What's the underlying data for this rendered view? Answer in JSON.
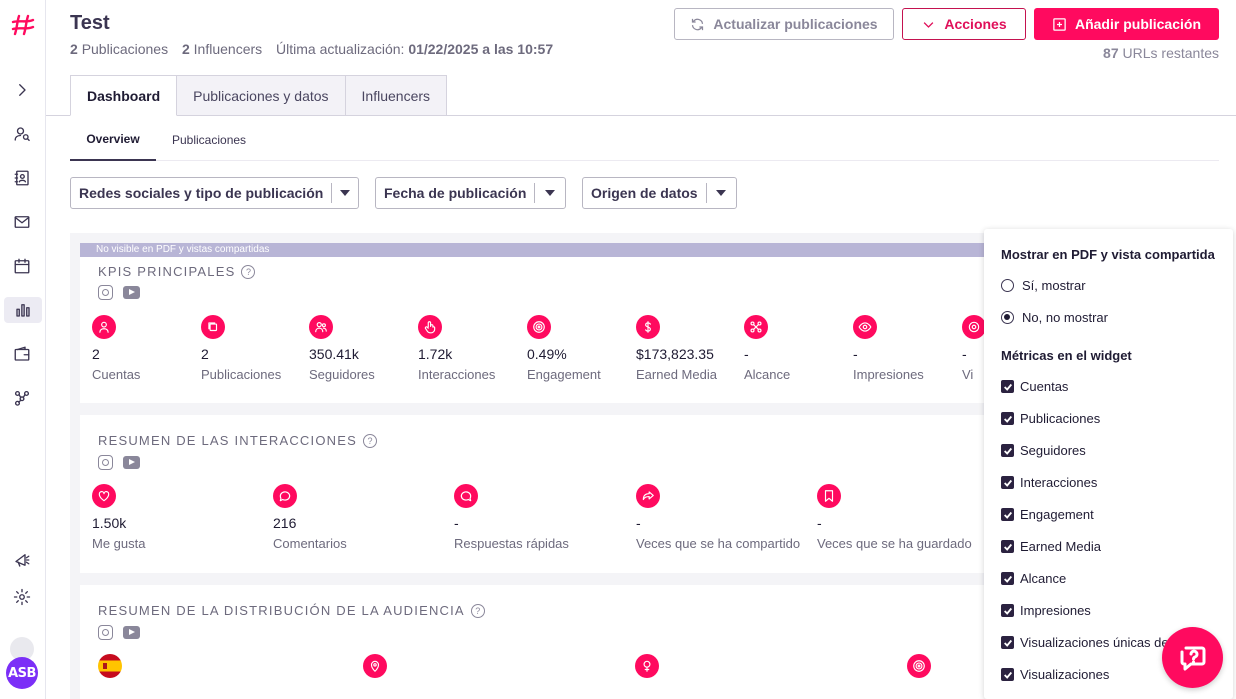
{
  "header": {
    "title": "Test",
    "posts_count": "2",
    "posts_label": "Publicaciones",
    "influencers_count": "2",
    "influencers_label": "Influencers",
    "last_update_label": "Última actualización:",
    "last_update_value": "01/22/2025 a las 10:57",
    "refresh_button": "Actualizar publicaciones",
    "actions_button": "Acciones",
    "add_button": "Añadir publicación",
    "urls_count": "87",
    "urls_label": "URLs restantes"
  },
  "sidebar": {
    "avatar_initials": "ASB",
    "icons": [
      "expand-icon",
      "user-search-icon",
      "contacts-icon",
      "mail-icon",
      "calendar-icon",
      "chart-icon",
      "wallet-icon",
      "network-icon",
      "megaphone-icon",
      "gear-icon"
    ]
  },
  "tabs": [
    "Dashboard",
    "Publicaciones y datos",
    "Influencers"
  ],
  "subtabs": [
    "Overview",
    "Publicaciones"
  ],
  "filters": [
    "Redes sociales y tipo de publicación",
    "Fecha de publicación",
    "Origen de datos"
  ],
  "banner": "No visible en PDF y vistas compartidas",
  "kpis": {
    "title": "KPIS PRINCIPALES",
    "metrics": [
      {
        "value": "2",
        "label": "Cuentas",
        "icon": "user-icon"
      },
      {
        "value": "2",
        "label": "Publicaciones",
        "icon": "posts-icon"
      },
      {
        "value": "350.41k",
        "label": "Seguidores",
        "icon": "followers-icon"
      },
      {
        "value": "1.72k",
        "label": "Interacciones",
        "icon": "tap-icon"
      },
      {
        "value": "0.49%",
        "label": "Engagement",
        "icon": "target-icon"
      },
      {
        "value": "$173,823.35",
        "label": "Earned Media",
        "icon": "dollar-icon"
      },
      {
        "value": "-",
        "label": "Alcance",
        "icon": "reach-icon"
      },
      {
        "value": "-",
        "label": "Impresiones",
        "icon": "eye-icon"
      },
      {
        "value": "-",
        "label": "Vi",
        "icon": "views-icon"
      }
    ]
  },
  "interactions": {
    "title": "RESUMEN DE LAS INTERACCIONES",
    "metrics": [
      {
        "value": "1.50k",
        "label": "Me gusta",
        "icon": "heart-icon"
      },
      {
        "value": "216",
        "label": "Comentarios",
        "icon": "comment-icon"
      },
      {
        "value": "-",
        "label": "Respuestas rápidas",
        "icon": "reply-icon"
      },
      {
        "value": "-",
        "label": "Veces que se ha compartido",
        "icon": "share-icon"
      },
      {
        "value": "-",
        "label": "Veces que se ha guardado",
        "icon": "bookmark-icon"
      }
    ]
  },
  "audience": {
    "title": "RESUMEN DE LA DISTRIBUCIÓN DE LA AUDIENCIA"
  },
  "panel": {
    "show_title": "Mostrar en PDF y vista compartida",
    "option_yes": "Sí, mostrar",
    "option_no": "No, no mostrar",
    "selected": "no",
    "metrics_title": "Métricas en el widget",
    "metrics": [
      "Cuentas",
      "Publicaciones",
      "Seguidores",
      "Interacciones",
      "Engagement",
      "Earned Media",
      "Alcance",
      "Impresiones",
      "Visualizaciones únicas de",
      "Visualizaciones"
    ]
  },
  "colors": {
    "brand": "#ff0a5f",
    "dark": "#3b3551",
    "avatar": "#7b2ff7"
  }
}
